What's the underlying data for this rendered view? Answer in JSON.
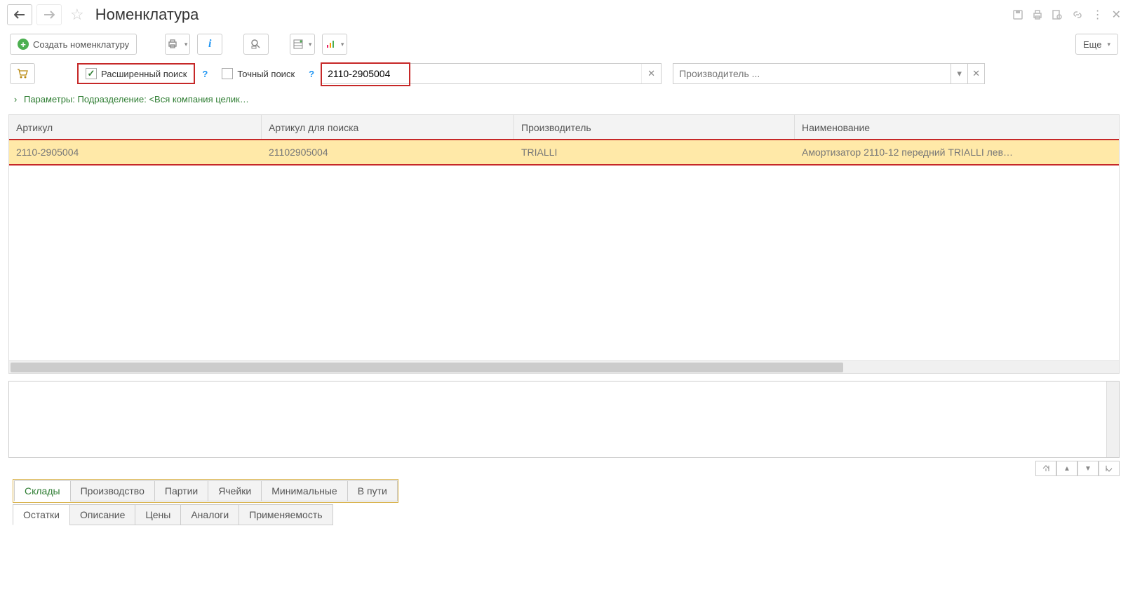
{
  "titlebar": {
    "title": "Номенклатура"
  },
  "toolbar": {
    "create_label": "Создать номенклатуру",
    "more_label": "Еще"
  },
  "filters": {
    "extended_search_label": "Расширенный поиск",
    "exact_search_label": "Точный поиск",
    "search_value": "2110-2905004",
    "manufacturer_placeholder": "Производитель ..."
  },
  "params": {
    "text": "Параметры: Подразделение: <Вся компания целик…"
  },
  "table": {
    "headers": {
      "article": "Артикул",
      "search_article": "Артикул для поиска",
      "manufacturer": "Производитель",
      "name": "Наименование"
    },
    "row": {
      "article": "2110-2905004",
      "search_article": "21102905004",
      "manufacturer": "TRIALLI",
      "name": "Амортизатор 2110-12 передний TRIALLI лев…"
    }
  },
  "tabs_upper": {
    "warehouses": "Склады",
    "production": "Производство",
    "batches": "Партии",
    "cells": "Ячейки",
    "minimal": "Минимальные",
    "in_transit": "В пути"
  },
  "tabs_lower": {
    "balances": "Остатки",
    "description": "Описание",
    "prices": "Цены",
    "analogs": "Аналоги",
    "applicability": "Применяемость"
  }
}
